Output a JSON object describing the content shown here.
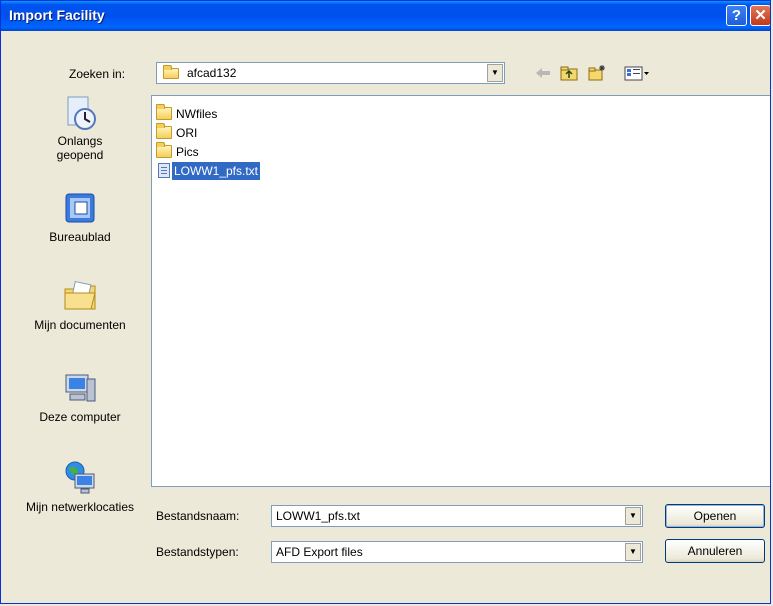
{
  "window": {
    "title": "Import Facility",
    "help_glyph": "?",
    "close_glyph": "✕"
  },
  "lookin": {
    "label": "Zoeken in:",
    "value": "afcad132",
    "icon": "folder-icon"
  },
  "toolbar": {
    "back_icon": "back-arrow-icon",
    "up_icon": "up-folder-icon",
    "new_folder_icon": "new-folder-icon",
    "views_icon": "views-menu-icon"
  },
  "places": [
    {
      "label": "Onlangs geopend",
      "icon": "recent-documents-icon"
    },
    {
      "label": "Bureaublad",
      "icon": "desktop-icon"
    },
    {
      "label": "Mijn documenten",
      "icon": "my-documents-icon"
    },
    {
      "label": "Deze computer",
      "icon": "my-computer-icon"
    },
    {
      "label": "Mijn netwerklocaties",
      "icon": "network-places-icon"
    }
  ],
  "files": [
    {
      "name": "NWfiles",
      "type": "folder"
    },
    {
      "name": "ORI",
      "type": "folder"
    },
    {
      "name": "Pics",
      "type": "folder"
    },
    {
      "name": "LOWW1_pfs.txt",
      "type": "text-file",
      "selected": true
    }
  ],
  "filename": {
    "label": "Bestandsnaam:",
    "value": "LOWW1_pfs.txt"
  },
  "filetype": {
    "label": "Bestandstypen:",
    "value": "AFD Export files"
  },
  "buttons": {
    "open": "Openen",
    "cancel": "Annuleren"
  }
}
